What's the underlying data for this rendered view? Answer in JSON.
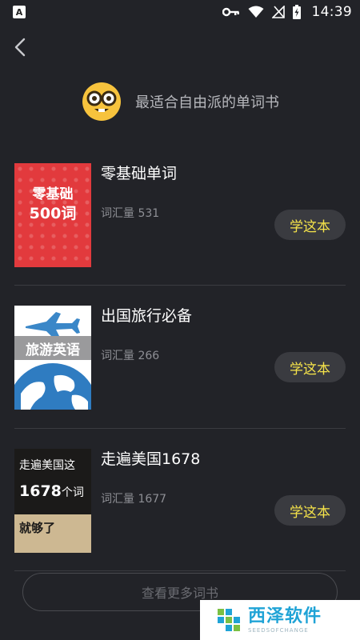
{
  "status_bar": {
    "app_badge": "A",
    "time": "14:39"
  },
  "header": {
    "subtitle": "最适合自由派的单词书",
    "emoji_icon": "nerd-face-icon"
  },
  "books": [
    {
      "title": "零基础单词",
      "count": "词汇量 531",
      "button": "学这本",
      "cover": {
        "line1": "零基础",
        "line2": "500词"
      }
    },
    {
      "title": "出国旅行必备",
      "count": "词汇量 266",
      "button": "学这本",
      "cover": {
        "line1": "旅游英语"
      }
    },
    {
      "title": "走遍美国1678",
      "count": "词汇量 1677",
      "button": "学这本",
      "cover": {
        "line1": "走遍美国这",
        "line2_num": "1678",
        "line2_unit": "个词",
        "line3": "就够了"
      }
    }
  ],
  "more_button": "查看更多词书",
  "watermark": {
    "name": "西泽软件",
    "sub": "SEEDSOFCHANGE"
  },
  "colors": {
    "background": "#222328",
    "accent_yellow": "#f5e34a",
    "button_bg": "#3a3b40"
  }
}
